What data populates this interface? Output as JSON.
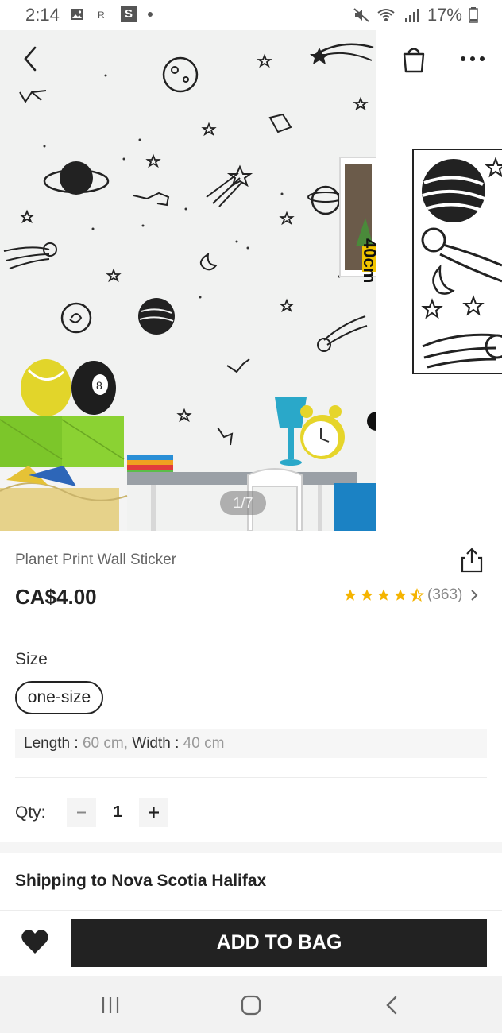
{
  "status_bar": {
    "time": "2:14",
    "battery": "17%",
    "icons": [
      "image-icon",
      "r-icon",
      "s-app-icon",
      "dot-icon",
      "mute-icon",
      "wifi-icon",
      "signal-icon",
      "battery-icon"
    ]
  },
  "gallery": {
    "page_indicator": "1/7",
    "dimension_label": "40cm",
    "back_icon": "chevron-left-icon",
    "bag_icon": "shopping-bag-icon",
    "more_icon": "more-dots-icon"
  },
  "product": {
    "title": "Planet Print Wall Sticker",
    "price": "CA$4.00",
    "rating": {
      "stars": 4.5,
      "count": "(363)"
    },
    "share_icon": "share-icon"
  },
  "size": {
    "label": "Size",
    "selected": "one-size",
    "length_key": "Length :",
    "length_value": "60 cm,",
    "width_key": "Width :",
    "width_value": "40 cm"
  },
  "quantity": {
    "label": "Qty:",
    "value": "1"
  },
  "shipping": {
    "label": "Shipping to Nova Scotia Halifax"
  },
  "actions": {
    "add_to_bag": "ADD TO BAG",
    "wishlist_icon": "heart-icon"
  },
  "colors": {
    "primary_button": "#222222",
    "star": "#f5b400",
    "text_secondary": "#999999"
  }
}
